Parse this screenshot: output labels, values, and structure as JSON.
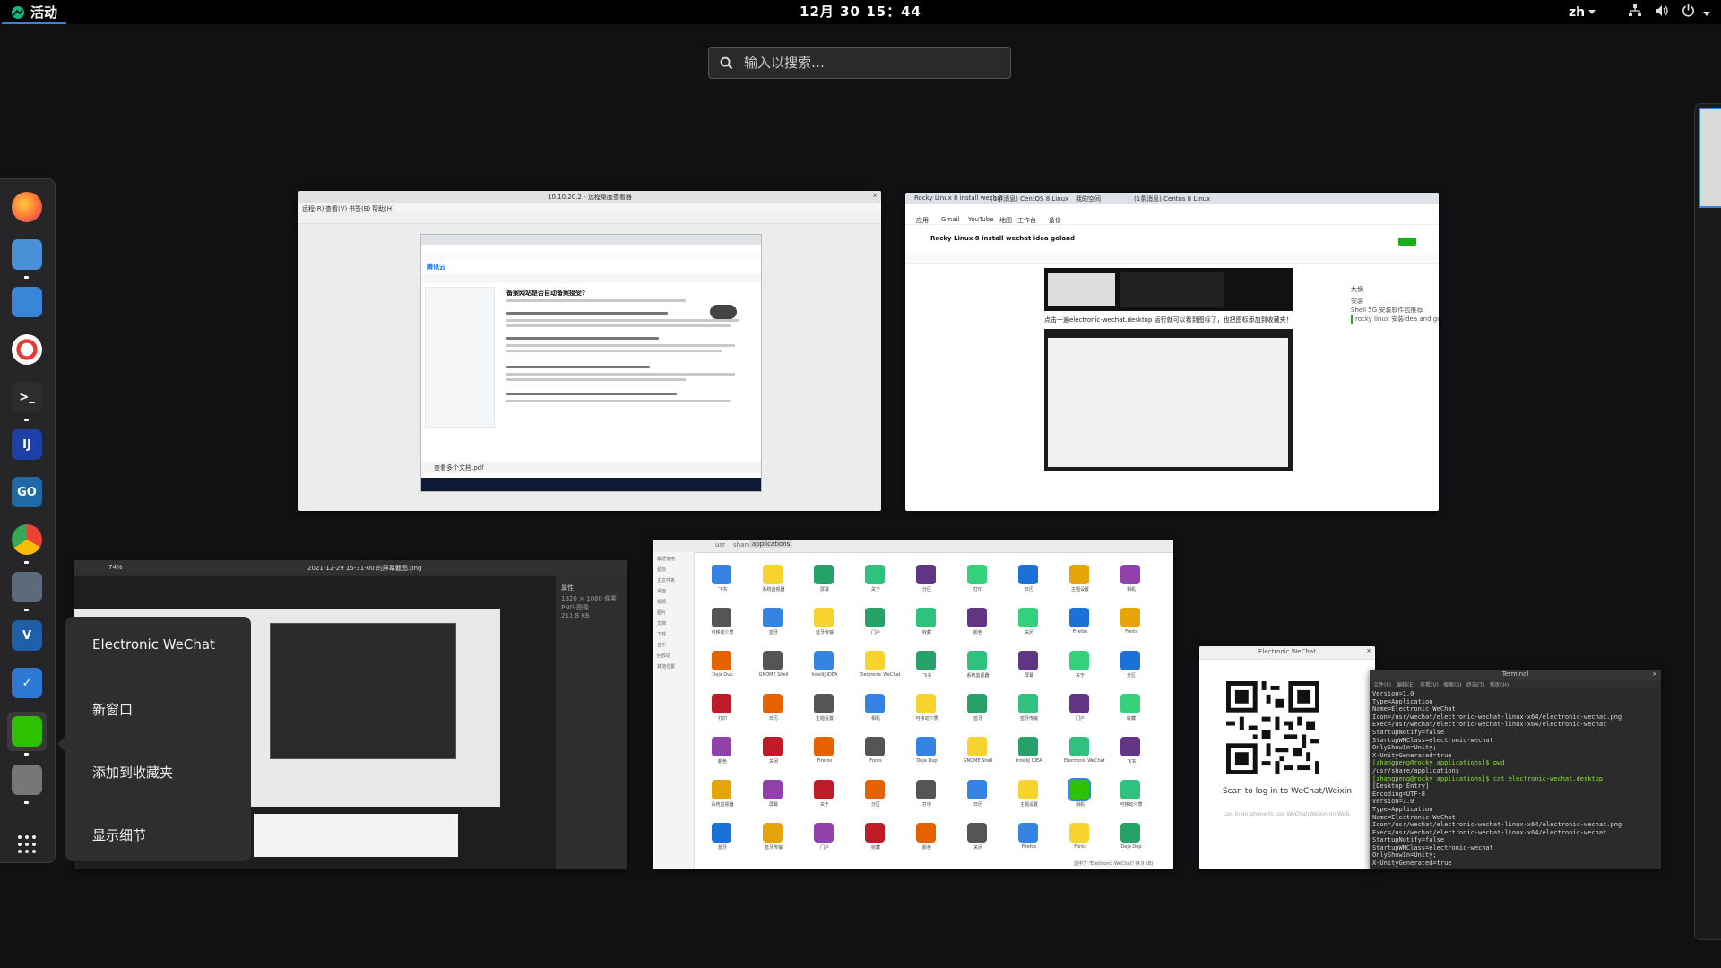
{
  "topbar": {
    "activities_label": "活动",
    "clock": "12月 30 15：44",
    "language": "zh"
  },
  "search": {
    "placeholder": "输入以搜索…"
  },
  "dock": {
    "items": [
      {
        "name": "firefox",
        "color": "#ff7139"
      },
      {
        "name": "files",
        "color": "#4a90d9"
      },
      {
        "name": "software",
        "color": "#3a86d6"
      },
      {
        "name": "help",
        "color": "#e5e5e5"
      },
      {
        "name": "terminal",
        "color": "#2d2d2d"
      },
      {
        "name": "intellij-idea",
        "color": "#1c3fa8"
      },
      {
        "name": "goland",
        "color": "#1e6aa8"
      },
      {
        "name": "chrome",
        "color": "#4285f4"
      },
      {
        "name": "remote-desktop",
        "color": "#5b6b7b"
      },
      {
        "name": "vim",
        "color": "#1f5fa8"
      },
      {
        "name": "clipboard",
        "color": "#2f79d6"
      },
      {
        "name": "electronic-wechat",
        "color": "#2dc100"
      },
      {
        "name": "image-viewer",
        "color": "#777"
      }
    ],
    "show_apps_label": "显示应用"
  },
  "context_menu": {
    "items": [
      "Electronic WeChat",
      "新窗口",
      "添加到收藏夹",
      "显示细节"
    ]
  },
  "windows": {
    "remote_desktop": {
      "title": "10.10.20.2 - 远程桌面查看器",
      "menu": [
        "远程(R)",
        "查看(V)",
        "书签(B)",
        "帮助(H)"
      ],
      "inner_brand": "腾讯云",
      "inner_heading": "备案网站是否自动备案接受?",
      "inner_file": "查看多个文档.pdf"
    },
    "chrome_doc": {
      "tabs": [
        "Rocky Linux 8 install wechat",
        "(1条消息) CentOS 8 Linux",
        "我的空间",
        "(1条消息) Centos 8 Linux"
      ],
      "bookmarks": [
        "应用",
        "Gmail",
        "YouTube",
        "地图",
        "工作台",
        "备份"
      ],
      "doc_title": "Rocky Linux 8 install wechat idea goland",
      "caption": "点击一遍electronic-wechat.desktop 运行就可以看到图标了，也把图标添加到收藏夹！",
      "outline": [
        "大纲",
        "安装",
        "Shell 5G 安装软件包推荐",
        "rocky linux 安装idea and goland"
      ]
    },
    "image_viewer": {
      "title": "2021-12-29 15-31-00 的屏幕截图.png",
      "zoom": "74%",
      "props": [
        "属性",
        "1920 × 1080 像素",
        "PNG 图像",
        "211.8 KB"
      ]
    },
    "file_manager": {
      "path": [
        "usr",
        "share",
        "applications"
      ],
      "sidebar": [
        "最近使用",
        "星标",
        "主文件夹",
        "桌面",
        "视频",
        "图片",
        "文档",
        "下载",
        "音乐",
        "回收站",
        "其他位置"
      ],
      "icon_labels": [
        "飞书",
        "系统监视器",
        "屏幕",
        "关于",
        "分区",
        "打印",
        "日历",
        "主题设置",
        "相机",
        "可移动介质",
        "蓝牙",
        "蓝牙传输",
        "门户",
        "收藏",
        "颜色",
        "关闭",
        "Firefox",
        "Fonts",
        "Deja Dup",
        "GNOME Shell",
        "IntelliJ IDEA",
        "Electronic WeChat"
      ],
      "search_hint": "选中了 \"Electronic WeChat\" (4.9 kB)"
    },
    "wechat": {
      "title": "Electronic WeChat",
      "scan_text": "Scan to log in to WeChat/Weixin",
      "sub_text": "Log in on phone to use WeChat/Weixin on Web."
    },
    "terminal": {
      "title": "Terminal",
      "menu": [
        "文件(F)",
        "编辑(E)",
        "查看(V)",
        "搜索(S)",
        "终端(T)",
        "帮助(H)"
      ],
      "lines": [
        "Version=1.0",
        "Type=Application",
        "Name=Electronic WeChat",
        "Icon=/usr/wechat/electronic-wechat-linux-x64/electronic-wechat.png",
        "Exec=/usr/wechat/electronic-wechat-linux-x64/electronic-wechat",
        "StartupNotify=false",
        "StartupWMClass=electronic-wechat",
        "OnlyShowIn=Unity;",
        "X-UnityGenerated=true",
        "[zhangpeng@rocky applications]$ pwd",
        "/usr/share/applications",
        "[zhangpeng@rocky applications]$ cat electronic-wechat.desktop",
        "[Desktop Entry]",
        "Encoding=UTF-8",
        "Version=1.0",
        "Type=Application",
        "Name=Electronic WeChat",
        "Icon=/usr/wechat/electronic-wechat-linux-x64/electronic-wechat.png",
        "Exec=/usr/wechat/electronic-wechat-linux-x64/electronic-wechat",
        "StartupNotify=false",
        "StartupWMClass=electronic-wechat",
        "OnlyShowIn=Unity;",
        "X-UnityGenerated=true",
        "[zhangpeng@rocky applications]$ []"
      ]
    }
  }
}
